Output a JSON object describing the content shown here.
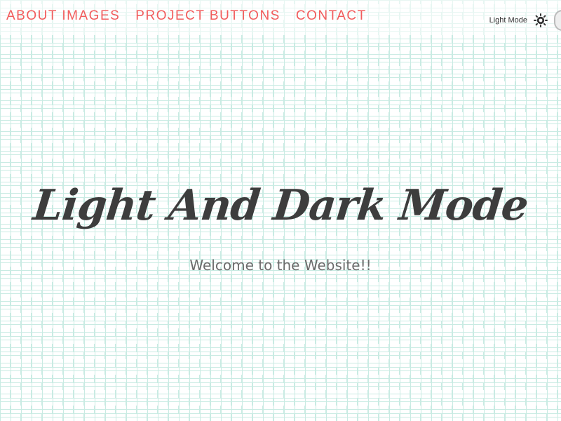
{
  "nav": {
    "links": [
      {
        "label": "ABOUT IMAGES"
      },
      {
        "label": "PROJECT BUTTONS"
      },
      {
        "label": "CONTACT"
      }
    ]
  },
  "theme": {
    "label": "Light Mode",
    "icon": "sun-icon",
    "mode": "light"
  },
  "hero": {
    "title": "Light And Dark Mode",
    "subtitle": "Welcome to the Website!!"
  },
  "colors": {
    "nav_link": "#f25c5c",
    "title": "#3d3d3d",
    "subtitle": "#6b6b6b",
    "brick_lines": "#c9ebe3",
    "background": "#ffffff"
  }
}
